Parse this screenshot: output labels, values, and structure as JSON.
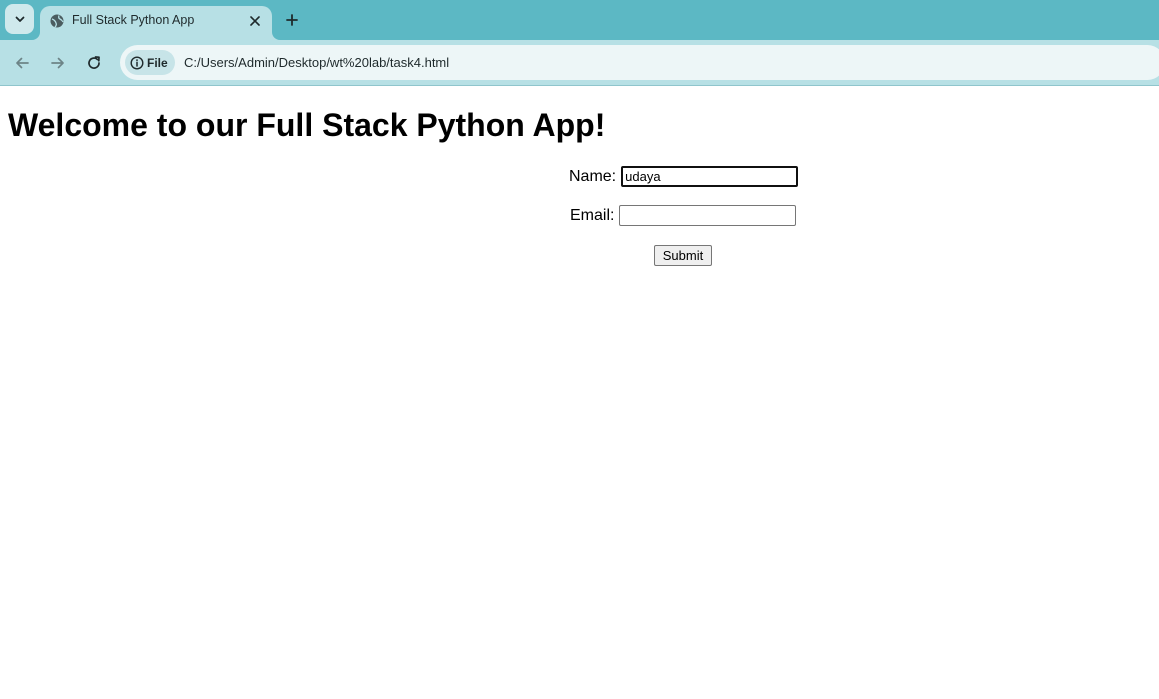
{
  "browser": {
    "tab": {
      "title": "Full Stack Python App"
    },
    "address_bar": {
      "site_chip": "File",
      "url": "C:/Users/Admin/Desktop/wt%20lab/task4.html"
    },
    "colors": {
      "tabstrip": "#5cb8c4",
      "toolbar": "#b7e0e5"
    },
    "icons": {
      "tab_search": "chevron-down-icon",
      "favicon": "globe-icon",
      "tab_close": "close-icon",
      "new_tab": "plus-icon",
      "back": "back-arrow-icon",
      "forward": "forward-arrow-icon",
      "reload": "reload-icon",
      "site_info": "info-icon"
    }
  },
  "page": {
    "heading": "Welcome to our Full Stack Python App!",
    "form": {
      "name_label": "Name:",
      "name_value": "udaya",
      "email_label": "Email:",
      "email_value": "",
      "submit_label": "Submit"
    }
  }
}
